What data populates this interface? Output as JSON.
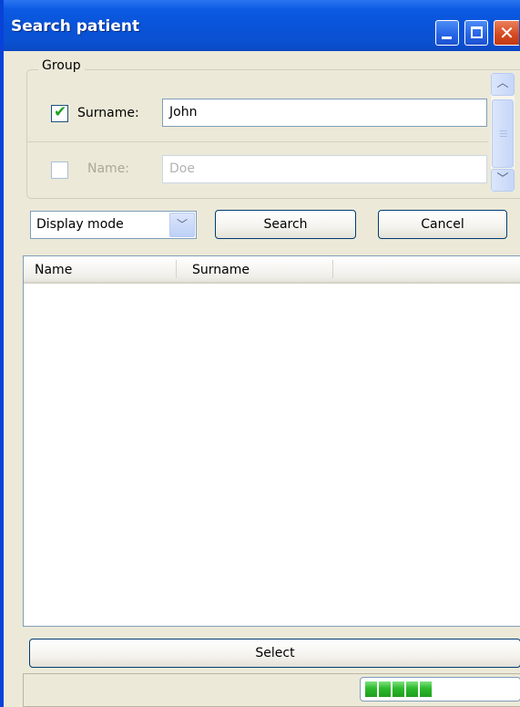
{
  "window": {
    "title": "Search patient",
    "controls": {
      "minimize": "minimize",
      "maximize": "maximize",
      "close": "✕"
    }
  },
  "group": {
    "label": "Group",
    "rows": [
      {
        "checked": true,
        "label": "Surname:",
        "value": "John",
        "enabled": true
      },
      {
        "checked": false,
        "label": "Name:",
        "value": "Doe",
        "enabled": false
      }
    ]
  },
  "toolbar": {
    "display_mode": "Display mode",
    "search_label": "Search",
    "cancel_label": "Cancel"
  },
  "results": {
    "columns": [
      "Name",
      "Surname"
    ],
    "rows": []
  },
  "footer": {
    "select_label": "Select",
    "progress_blocks": 5
  },
  "colors": {
    "titlebar": "#0853D9",
    "window_bg": "#ECE9D8",
    "progress": "#2CBA2C",
    "check": "#21A121"
  },
  "icons": {
    "checkbox_checked": "check-icon",
    "scroll_up": "chevron-up-icon",
    "scroll_down": "chevron-down-icon",
    "combo_arrow": "chevron-down-icon"
  }
}
